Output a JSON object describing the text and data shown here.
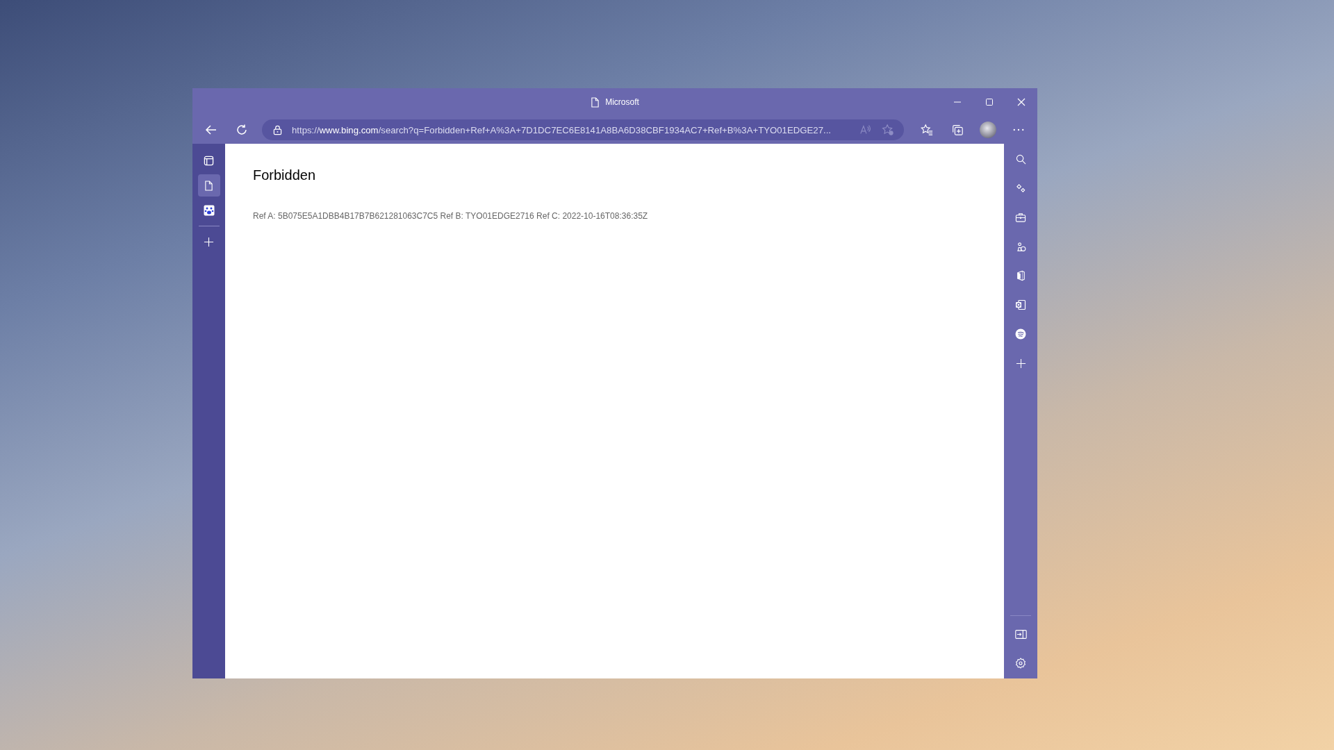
{
  "window": {
    "title": "Microsoft"
  },
  "address_bar": {
    "url_scheme": "https://",
    "url_host": "www.bing.com",
    "url_rest": "/search?q=Forbidden+Ref+A%3A+7D1DC7EC6E8141A8BA6D38CBF1934AC7+Ref+B%3A+TYO01EDGE27..."
  },
  "vertical_tabs": [
    {
      "kind": "page",
      "selected": true
    },
    {
      "kind": "paw",
      "selected": false
    }
  ],
  "page": {
    "heading": "Forbidden",
    "refs": "Ref A: 5B075E5A1DBB4B17B7B621281063C7C5 Ref B: TYO01EDGE2716 Ref C: 2022-10-16T08:36:35Z"
  }
}
